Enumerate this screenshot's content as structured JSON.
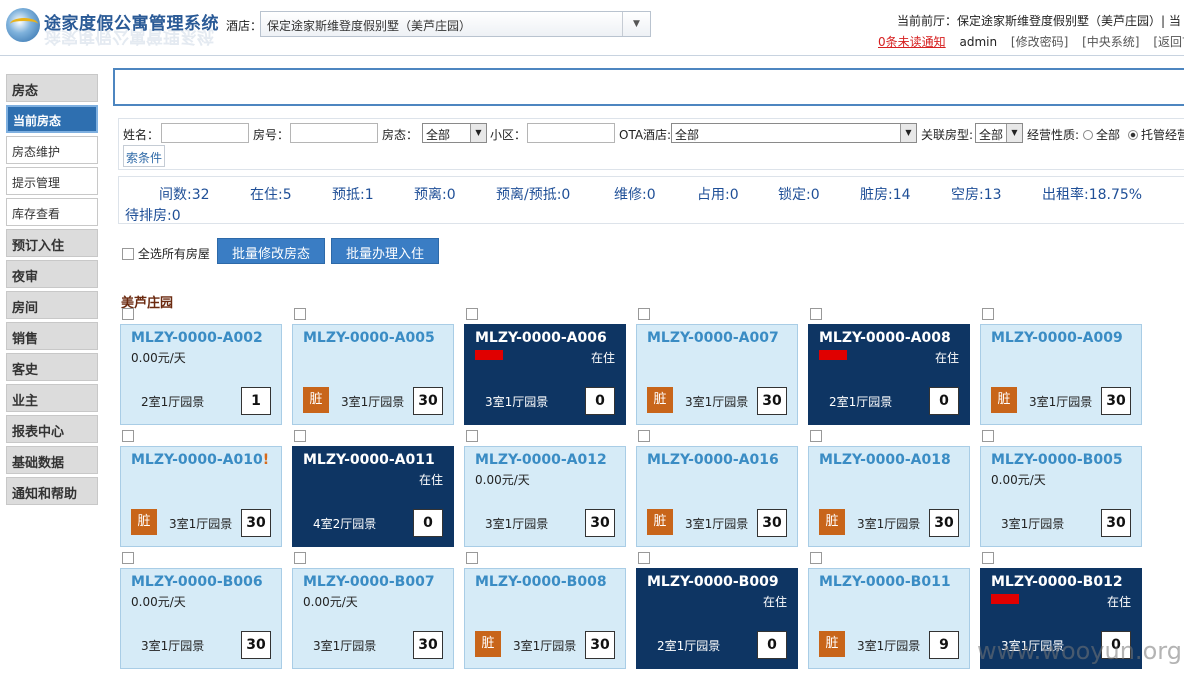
{
  "app": {
    "title": "途家度假公寓管理系统"
  },
  "header": {
    "hotel_label": "酒店：",
    "hotel_value": "保定途家斯维登度假别墅（美芦庄园）",
    "front_desk": "当前前厅：保定途家斯维登度假别墅（美芦庄园）| 当",
    "unread_notice": "0条未读通知",
    "user": "admin",
    "links": [
      "[修改密码]",
      "[中央系统]",
      "[返回首"
    ]
  },
  "sidebar": {
    "items": [
      {
        "label": "房态",
        "type": "section"
      },
      {
        "label": "当前房态",
        "type": "active"
      },
      {
        "label": "房态维护",
        "type": "sub"
      },
      {
        "label": "提示管理",
        "type": "sub"
      },
      {
        "label": "库存查看",
        "type": "sub"
      },
      {
        "label": "预订入住",
        "type": "section"
      },
      {
        "label": "夜审",
        "type": "section"
      },
      {
        "label": "房间",
        "type": "section"
      },
      {
        "label": "销售",
        "type": "section"
      },
      {
        "label": "客史",
        "type": "section"
      },
      {
        "label": "业主",
        "type": "section"
      },
      {
        "label": "报表中心",
        "type": "section"
      },
      {
        "label": "基础数据",
        "type": "section"
      },
      {
        "label": "通知和帮助",
        "type": "section"
      }
    ]
  },
  "filters": {
    "name_label": "姓名：",
    "room_no_label": "房号：",
    "room_status_label": "房态：",
    "room_status_value": "全部",
    "district_label": "小区：",
    "ota_label": "OTA酒店:",
    "ota_value": "全部",
    "room_type_label": "关联房型:",
    "room_type_value": "全部",
    "nature_label": "经营性质:",
    "nature_all": "全部",
    "nature_managed": "托管经营",
    "conditions_button": "索条件"
  },
  "stats": {
    "row1": [
      "间数:32",
      "在住:5",
      "预抵:1",
      "预离:0",
      "预离/预抵:0",
      "维修:0",
      "占用:0",
      "锁定:0",
      "脏房:14",
      "空房:13",
      "出租率:18.75%"
    ],
    "row2": "待排房:0"
  },
  "batch": {
    "select_all": "全选所有房屋",
    "batch_status": "批量修改房态",
    "batch_checkin": "批量办理入住"
  },
  "group_title": "美芦庄园",
  "rooms": [
    {
      "code": "MLZY-0000-A002",
      "mark": "",
      "price": "0.00元/天",
      "status": "",
      "occupied": false,
      "redacted": false,
      "dirty": false,
      "room_type": "2室1厅园景",
      "days": "1"
    },
    {
      "code": "MLZY-0000-A005",
      "mark": "",
      "price": "",
      "status": "",
      "occupied": false,
      "redacted": false,
      "dirty": true,
      "room_type": "3室1厅园景",
      "days": "30"
    },
    {
      "code": "MLZY-0000-A006",
      "mark": "",
      "price": "",
      "status": "在住",
      "occupied": true,
      "redacted": true,
      "dirty": false,
      "room_type": "3室1厅园景",
      "days": "0"
    },
    {
      "code": "MLZY-0000-A007",
      "mark": "",
      "price": "",
      "status": "",
      "occupied": false,
      "redacted": false,
      "dirty": true,
      "room_type": "3室1厅园景",
      "days": "30"
    },
    {
      "code": "MLZY-0000-A008",
      "mark": "",
      "price": "",
      "status": "在住",
      "occupied": true,
      "redacted": true,
      "dirty": false,
      "room_type": "2室1厅园景",
      "days": "0"
    },
    {
      "code": "MLZY-0000-A009",
      "mark": "",
      "price": "",
      "status": "",
      "occupied": false,
      "redacted": false,
      "dirty": true,
      "room_type": "3室1厅园景",
      "days": "30"
    },
    {
      "code": "MLZY-0000-A010",
      "mark": "!",
      "price": "",
      "status": "",
      "occupied": false,
      "redacted": false,
      "dirty": true,
      "room_type": "3室1厅园景",
      "days": "30"
    },
    {
      "code": "MLZY-0000-A011",
      "mark": "",
      "price": "",
      "status": "在住",
      "occupied": true,
      "redacted": false,
      "dirty": false,
      "room_type": "4室2厅园景",
      "days": "0"
    },
    {
      "code": "MLZY-0000-A012",
      "mark": "",
      "price": "0.00元/天",
      "status": "",
      "occupied": false,
      "redacted": false,
      "dirty": false,
      "room_type": "3室1厅园景",
      "days": "30"
    },
    {
      "code": "MLZY-0000-A016",
      "mark": "",
      "price": "",
      "status": "",
      "occupied": false,
      "redacted": false,
      "dirty": true,
      "room_type": "3室1厅园景",
      "days": "30"
    },
    {
      "code": "MLZY-0000-A018",
      "mark": "",
      "price": "",
      "status": "",
      "occupied": false,
      "redacted": false,
      "dirty": true,
      "room_type": "3室1厅园景",
      "days": "30"
    },
    {
      "code": "MLZY-0000-B005",
      "mark": "",
      "price": "0.00元/天",
      "status": "",
      "occupied": false,
      "redacted": false,
      "dirty": false,
      "room_type": "3室1厅园景",
      "days": "30"
    },
    {
      "code": "MLZY-0000-B006",
      "mark": "",
      "price": "0.00元/天",
      "status": "",
      "occupied": false,
      "redacted": false,
      "dirty": false,
      "room_type": "3室1厅园景",
      "days": "30"
    },
    {
      "code": "MLZY-0000-B007",
      "mark": "",
      "price": "0.00元/天",
      "status": "",
      "occupied": false,
      "redacted": false,
      "dirty": false,
      "room_type": "3室1厅园景",
      "days": "30"
    },
    {
      "code": "MLZY-0000-B008",
      "mark": "",
      "price": "",
      "status": "",
      "occupied": false,
      "redacted": false,
      "dirty": true,
      "room_type": "3室1厅园景",
      "days": "30"
    },
    {
      "code": "MLZY-0000-B009",
      "mark": "",
      "price": "",
      "status": "在住",
      "occupied": true,
      "redacted": false,
      "dirty": false,
      "room_type": "2室1厅园景",
      "days": "0"
    },
    {
      "code": "MLZY-0000-B011",
      "mark": "",
      "price": "",
      "status": "",
      "occupied": false,
      "redacted": false,
      "dirty": true,
      "room_type": "3室1厅园景",
      "days": "9"
    },
    {
      "code": "MLZY-0000-B012",
      "mark": "",
      "price": "",
      "status": "在住",
      "occupied": true,
      "redacted": true,
      "dirty": false,
      "room_type": "3室1厅园景",
      "days": "0"
    }
  ],
  "dirty_label": "脏",
  "watermark": "www.wooyun.org",
  "colors": {
    "accent": "#2e6fb0",
    "tile_vacant": "#d6ebf7",
    "tile_occupied": "#0e3563",
    "dirty_badge": "#c8651a"
  }
}
